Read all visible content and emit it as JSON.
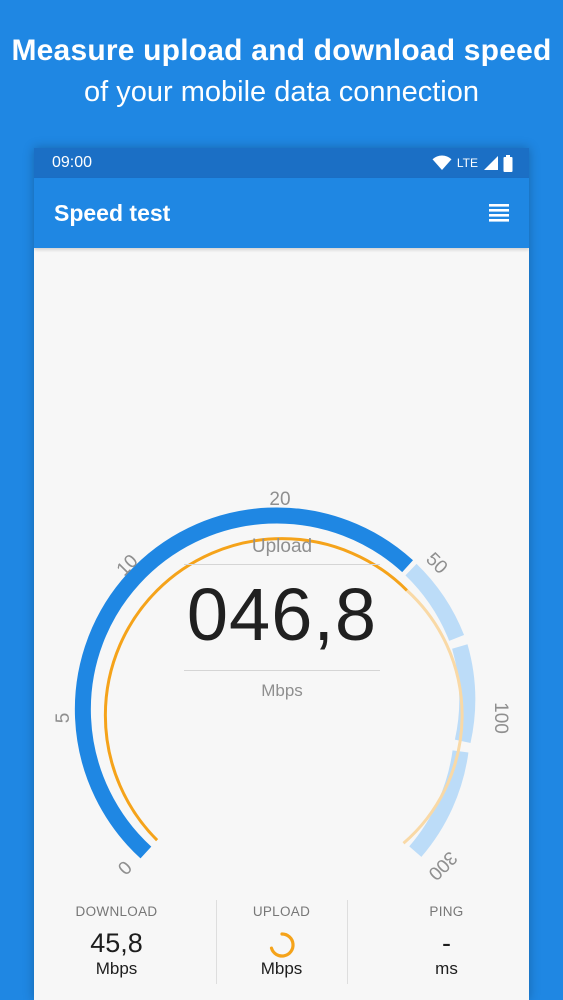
{
  "promo": {
    "line1": "Measure upload and download speed",
    "line2": "of your mobile data connection"
  },
  "status_bar": {
    "time": "09:00",
    "network": "LTE",
    "icons": [
      "wifi-icon",
      "signal-icon",
      "battery-icon"
    ]
  },
  "app_bar": {
    "title": "Speed test",
    "menu_icon": "menu-icon"
  },
  "gauge": {
    "mode_label": "Upload",
    "value": "046,8",
    "unit": "Mbps",
    "scale_labels": [
      "0",
      "5",
      "10",
      "20",
      "50",
      "100",
      "300"
    ],
    "current_value": 46.8,
    "progress_color": "#f5a31a",
    "fill_color": "#1f87e3",
    "remaining_color": "#bcdcf8"
  },
  "stats": {
    "download": {
      "label": "DOWNLOAD",
      "value": "45,8",
      "unit": "Mbps"
    },
    "upload": {
      "label": "UPLOAD",
      "value": "",
      "unit": "Mbps",
      "icon": "loading-spinner-icon"
    },
    "ping": {
      "label": "PING",
      "value": "-",
      "unit": "ms"
    }
  },
  "colors": {
    "brand": "#1f87e3",
    "status_bar": "#1b6fc5",
    "accent": "#f5a31a"
  }
}
